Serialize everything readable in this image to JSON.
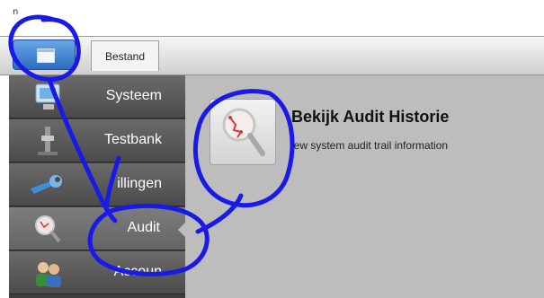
{
  "corner_mark": "n",
  "ribbon": {
    "app_button_icon": "window-icon",
    "tabs": [
      {
        "label": "Bestand"
      }
    ]
  },
  "sidebar": {
    "items": [
      {
        "label": "Systeem",
        "icon": "computer-icon",
        "active": false
      },
      {
        "label": "Testbank",
        "icon": "test-bench-icon",
        "active": false
      },
      {
        "label": "illingen",
        "icon": "wrench-icon",
        "active": false
      },
      {
        "label": "Audit",
        "icon": "magnifier-icon",
        "active": true
      },
      {
        "label": "Accoun",
        "icon": "users-icon",
        "active": false
      }
    ]
  },
  "content": {
    "tile": {
      "title": "Bekijk Audit Historie",
      "description": "iew system audit trail information",
      "icon": "magnifier-icon"
    }
  },
  "colors": {
    "ribbon": "#d9d9d9",
    "sidebar": "#4b4b4b",
    "content": "#bdbdbd",
    "annotation": "#1a1ae6"
  }
}
